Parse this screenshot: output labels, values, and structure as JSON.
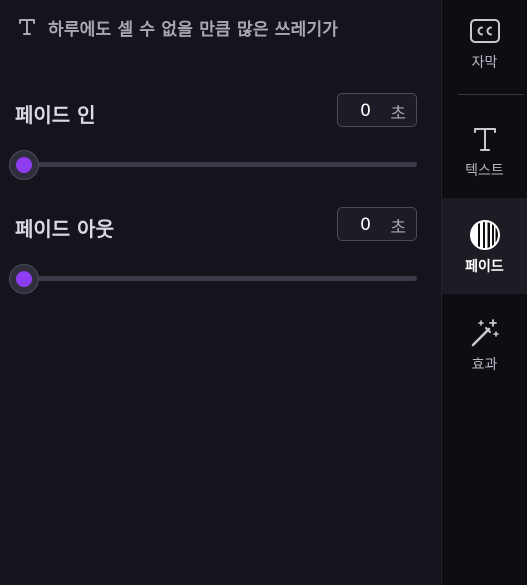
{
  "title": {
    "icon": "text-icon",
    "text": "하루에도 셀 수 없을 만큼 많은 쓰레기가"
  },
  "fade_in": {
    "label": "페이드 인",
    "value": "0",
    "unit": "초",
    "slider_value": 0
  },
  "fade_out": {
    "label": "페이드 아웃",
    "value": "0",
    "unit": "초",
    "slider_value": 0
  },
  "sidebar": {
    "items": [
      {
        "id": "subtitle",
        "label": "자막",
        "icon": "cc-icon",
        "active": false
      },
      {
        "id": "text",
        "label": "텍스트",
        "icon": "text-icon",
        "active": false
      },
      {
        "id": "fade",
        "label": "페이드",
        "icon": "fade-icon",
        "active": true
      },
      {
        "id": "effect",
        "label": "효과",
        "icon": "magic-wand-icon",
        "active": false
      }
    ]
  },
  "colors": {
    "accent": "#8e3cf0",
    "background": "#14141c",
    "sidebar_background": "#0d0d12"
  }
}
